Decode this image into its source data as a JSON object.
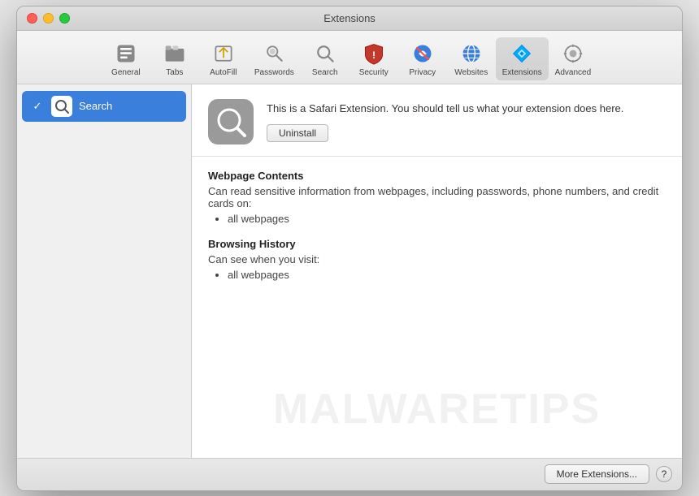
{
  "window": {
    "title": "Extensions"
  },
  "toolbar": {
    "items": [
      {
        "id": "general",
        "label": "General",
        "icon": "general"
      },
      {
        "id": "tabs",
        "label": "Tabs",
        "icon": "tabs"
      },
      {
        "id": "autofill",
        "label": "AutoFill",
        "icon": "autofill"
      },
      {
        "id": "passwords",
        "label": "Passwords",
        "icon": "passwords"
      },
      {
        "id": "search",
        "label": "Search",
        "icon": "search"
      },
      {
        "id": "security",
        "label": "Security",
        "icon": "security"
      },
      {
        "id": "privacy",
        "label": "Privacy",
        "icon": "privacy"
      },
      {
        "id": "websites",
        "label": "Websites",
        "icon": "websites"
      },
      {
        "id": "extensions",
        "label": "Extensions",
        "icon": "extensions",
        "active": true
      },
      {
        "id": "advanced",
        "label": "Advanced",
        "icon": "advanced"
      }
    ]
  },
  "sidebar": {
    "items": [
      {
        "id": "search-ext",
        "name": "Search",
        "enabled": true,
        "active": true
      }
    ]
  },
  "extension_detail": {
    "description": "This is a Safari Extension. You should tell us what your extension does here.",
    "uninstall_label": "Uninstall",
    "permissions": [
      {
        "title": "Webpage Contents",
        "description": "Can read sensitive information from webpages, including passwords, phone numbers, and credit cards on:",
        "items": [
          "all webpages"
        ]
      },
      {
        "title": "Browsing History",
        "description": "Can see when you visit:",
        "items": [
          "all webpages"
        ]
      }
    ]
  },
  "footer": {
    "more_extensions_label": "More Extensions...",
    "help_label": "?"
  },
  "watermark": {
    "text": "MALWARETIPS"
  }
}
